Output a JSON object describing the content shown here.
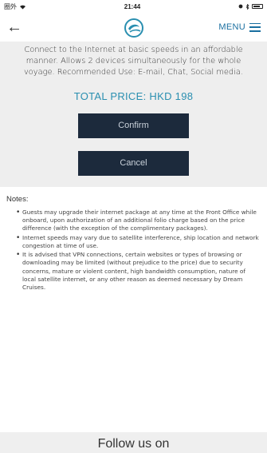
{
  "status_bar": {
    "carrier": "圈外",
    "time": "21:44"
  },
  "header": {
    "back_symbol": "←",
    "menu_label": "MENU"
  },
  "package": {
    "description": "Connect to the Internet at basic speeds in an affordable manner. Allows 2 devices simultaneously for the whole voyage. Recommended Use: E-mail, Chat, Social media.",
    "total_price": "TOTAL PRICE: HKD 198",
    "confirm_label": "Confirm",
    "cancel_label": "Cancel"
  },
  "notes": {
    "title": "Notes:",
    "items": [
      "Guests may upgrade their internet package at any time at the Front Office while onboard, upon authorization of an additional folio charge based on the price difference (with the exception of the complimentary packages).",
      "Internet speeds may vary due to satellite interference, ship location and network congestion at time of use.",
      "It is advised that VPN connections, certain websites or types of browsing or downloading may be limited (without prejudice to the price) due to security concerns, mature or violent content, high bandwidth consumption, nature of local satellite internet, or any other reason as deemed necessary by Dream Cruises."
    ]
  },
  "footer": {
    "follow_text": "Follow us on"
  },
  "colors": {
    "accent": "#2a8fb0",
    "menu": "#1a6fa0",
    "button_bg": "#1c2a3c",
    "panel_bg": "#eeeeee"
  },
  "icons": {
    "back": "arrow-left-icon",
    "logo": "dream-cruises-logo",
    "menu": "hamburger-icon",
    "wifi": "wifi-icon",
    "battery": "battery-icon"
  }
}
